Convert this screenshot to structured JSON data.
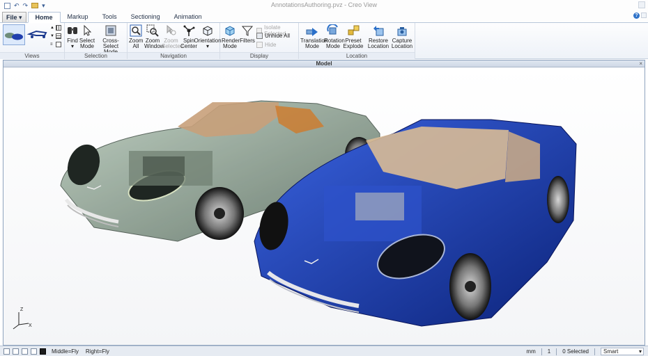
{
  "window": {
    "title": "AnnotationsAuthoring.pvz - Creo View"
  },
  "quick_access": {
    "items": [
      "new-icon",
      "undo-icon",
      "redo-icon",
      "open-icon",
      "customize-icon"
    ]
  },
  "tabs": [
    {
      "label": "File ▾"
    },
    {
      "label": "Home"
    },
    {
      "label": "Markup"
    },
    {
      "label": "Tools"
    },
    {
      "label": "Sectioning"
    },
    {
      "label": "Animation"
    }
  ],
  "ribbon": {
    "groups": {
      "views": "Views",
      "selection": "Selection",
      "navigation": "Navigation",
      "display": "Display",
      "location": "Location"
    },
    "selection": {
      "find": "Find",
      "select_mode": "Select Mode",
      "cross_select": "Cross-Select Mode"
    },
    "navigation": {
      "zoom_all": "Zoom All",
      "zoom_window": "Zoom Window",
      "zoom_selected": "Zoom Selected",
      "spin_center": "Spin Center",
      "orientation": "Orientation"
    },
    "display": {
      "render_mode": "Render Mode",
      "filters": "Filters",
      "isolate_selected": "Isolate Selected",
      "unhide_all": "Unhide All",
      "hide": "Hide"
    },
    "location": {
      "translation": "Translation Mode",
      "rotation": "Rotation Mode",
      "preset": "Preset Explode",
      "restore": "Restore Location",
      "capture": "Capture Location"
    }
  },
  "viewport": {
    "title": "Model",
    "close": "×"
  },
  "axes": {
    "z": "Z",
    "x": "X",
    "y": "Y"
  },
  "status": {
    "middle": "Middle=Fly",
    "right": "Right=Fly",
    "units": "mm",
    "count": "1",
    "selected": "0 Selected",
    "mode": "Smart"
  },
  "colors": {
    "car_translucent": "#7f9a86",
    "car_blue": "#1a3fb8",
    "interior_tan": "#c8a07a"
  }
}
